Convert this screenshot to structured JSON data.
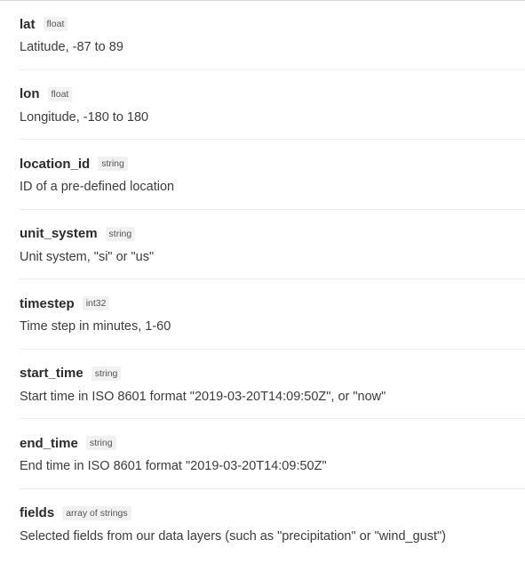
{
  "params": [
    {
      "name": "lat",
      "type": "float",
      "description": "Latitude, -87 to 89"
    },
    {
      "name": "lon",
      "type": "float",
      "description": "Longitude, -180 to 180"
    },
    {
      "name": "location_id",
      "type": "string",
      "description": "ID of a pre-defined location"
    },
    {
      "name": "unit_system",
      "type": "string",
      "description": "Unit system, \"si\" or \"us\""
    },
    {
      "name": "timestep",
      "type": "int32",
      "description": "Time step in minutes, 1-60"
    },
    {
      "name": "start_time",
      "type": "string",
      "description": "Start time in ISO 8601 format \"2019-03-20T14:09:50Z\", or \"now\""
    },
    {
      "name": "end_time",
      "type": "string",
      "description": "End time in ISO 8601 format \"2019-03-20T14:09:50Z\""
    },
    {
      "name": "fields",
      "type": "array of strings",
      "description": "Selected fields from our data layers (such as \"precipitation\" or \"wind_gust\")"
    }
  ]
}
